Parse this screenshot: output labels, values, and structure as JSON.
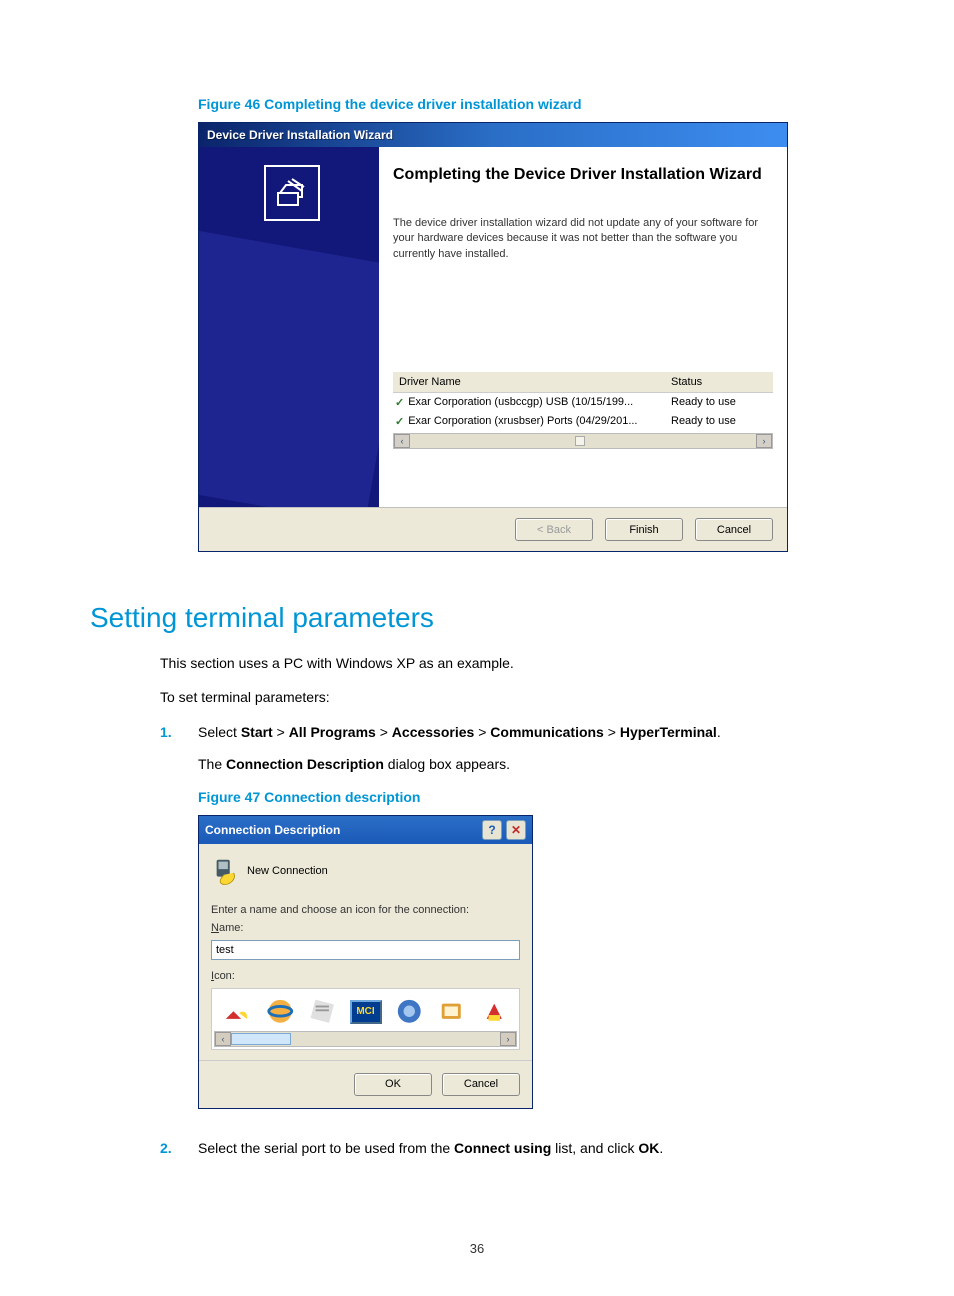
{
  "figure46": {
    "caption": "Figure 46 Completing the device driver installation wizard",
    "titlebar": "Device Driver Installation Wizard",
    "heading": "Completing the Device Driver Installation Wizard",
    "description": "The device driver installation wizard did not update any of your software for your hardware devices because it was not better than the software you currently have installed.",
    "table_headers": {
      "name": "Driver Name",
      "status": "Status"
    },
    "drivers": [
      {
        "name": "Exar Corporation (usbccgp) USB  (10/15/199...",
        "status": "Ready to use"
      },
      {
        "name": "Exar Corporation (xrusbser) Ports  (04/29/201...",
        "status": "Ready to use"
      }
    ],
    "buttons": {
      "back": "< Back",
      "finish": "Finish",
      "cancel": "Cancel"
    }
  },
  "section_heading": "Setting terminal parameters",
  "intro_para": "This section uses a PC with Windows XP as an example.",
  "to_set": "To set terminal parameters:",
  "step1": {
    "num": "1.",
    "select": "Select ",
    "start": "Start",
    "gt": " > ",
    "all_programs": "All Programs",
    "accessories": "Accessories",
    "communications": "Communications",
    "hyperterminal": "HyperTerminal",
    "period": ".",
    "sub1a": "The ",
    "sub1b": "Connection Description",
    "sub1c": " dialog box appears."
  },
  "figure47": {
    "caption": "Figure 47 Connection description",
    "titlebar": "Connection Description",
    "new_connection": "New Connection",
    "prompt": "Enter a name and choose an icon for the connection:",
    "name_label_u": "N",
    "name_label_rest": "ame:",
    "name_value": "test",
    "icon_label_u": "I",
    "icon_label_rest": "con:",
    "mci": "MCI",
    "ok": "OK",
    "cancel": "Cancel"
  },
  "step2": {
    "num": "2.",
    "a": "Select the serial port to be used from the ",
    "b": "Connect using",
    "c": " list, and click ",
    "d": "OK",
    "e": "."
  },
  "page_number": "36"
}
